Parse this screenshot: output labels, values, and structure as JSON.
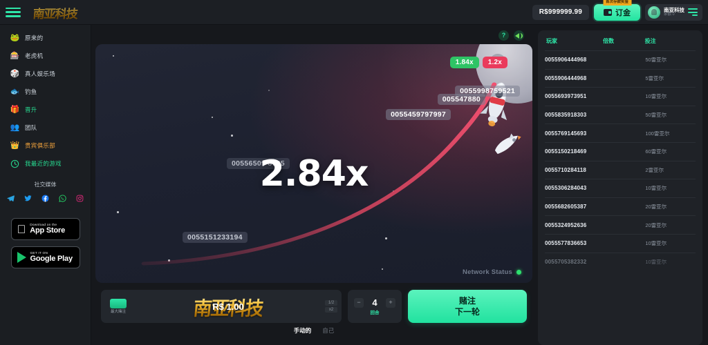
{
  "topbar": {
    "menu_icon": "hamburger-menu-icon",
    "brand": "南亚科技",
    "balance": "R$999999.99",
    "deposit_label": "订金",
    "deposit_badge": "首次存款奖金",
    "deposit_icon": "wallet-icon",
    "user_name": "南亚科技",
    "user_sub": "余额 0",
    "user_menu_icon": "user-menu-icon"
  },
  "sidebar": {
    "items": [
      {
        "label": "原来的",
        "icon": "frog-icon",
        "accent": "default"
      },
      {
        "label": "老虎机",
        "icon": "slot-machine-icon",
        "accent": "default"
      },
      {
        "label": "真人娱乐场",
        "icon": "live-casino-icon",
        "accent": "default"
      },
      {
        "label": "钓鱼",
        "icon": "fishing-icon",
        "accent": "default"
      },
      {
        "label": "晋升",
        "icon": "gift-icon",
        "accent": "green"
      },
      {
        "label": "团队",
        "icon": "team-icon",
        "accent": "default"
      },
      {
        "label": "贵宾俱乐部",
        "icon": "crown-icon",
        "accent": "orange"
      },
      {
        "label": "我最近的游戏",
        "icon": "clock-icon",
        "accent": "green"
      }
    ],
    "social_title": "社交媒体",
    "social": [
      {
        "name": "telegram-icon",
        "color": "#2aa3e0"
      },
      {
        "name": "twitter-icon",
        "color": "#1d9bf0"
      },
      {
        "name": "facebook-icon",
        "color": "#1877f2"
      },
      {
        "name": "whatsapp-icon",
        "color": "#25d366"
      },
      {
        "name": "instagram-icon",
        "color": "#d62976"
      }
    ],
    "stores": [
      {
        "small": "Download on the",
        "big": "App Store",
        "glyph": "apple-icon"
      },
      {
        "small": "GET IT ON",
        "big": "Google Play",
        "glyph": "google-play-icon"
      }
    ]
  },
  "game": {
    "help_icon": "help-icon",
    "sound_icon": "sound-on-icon",
    "multiplier": "2.84x",
    "history_chips": [
      {
        "value": "1.84x",
        "tone": "green"
      },
      {
        "value": "1.2x",
        "tone": "red"
      }
    ],
    "nameplates": [
      "0055998759521",
      "005547880",
      "0055459797997",
      "0055151233194",
      "00556509 8725"
    ],
    "network_status_label": "Network Status",
    "network_status_color": "#2ee06e"
  },
  "controls": {
    "max_bet_label": "最大赌注",
    "bet_amount": "R$ 1.00",
    "bet_watermark": "南亚科技",
    "half_label": "1/2",
    "double_label": "x2",
    "qty_value": "4",
    "qty_label": "回合",
    "qty_minus": "−",
    "qty_plus": "+",
    "bet_line1": "赌注",
    "bet_line2": "下一轮",
    "tabs": [
      {
        "label": "手动的",
        "active": true
      },
      {
        "label": "自己",
        "active": false
      }
    ]
  },
  "leaderboard": {
    "columns": [
      "玩家",
      "倍数",
      "投注"
    ],
    "rows": [
      {
        "player": "0055906444968",
        "mult": "",
        "bet": "50雷亚尔",
        "faded": false
      },
      {
        "player": "0055906444968",
        "mult": "",
        "bet": "5雷亚尔",
        "faded": false
      },
      {
        "player": "0055693973951",
        "mult": "",
        "bet": "10雷亚尔",
        "faded": false
      },
      {
        "player": "0055835918303",
        "mult": "",
        "bet": "50雷亚尔",
        "faded": false
      },
      {
        "player": "0055769145693",
        "mult": "",
        "bet": "100雷亚尔",
        "faded": false
      },
      {
        "player": "0055150218469",
        "mult": "",
        "bet": "60雷亚尔",
        "faded": false
      },
      {
        "player": "0055710284118",
        "mult": "",
        "bet": "2雷亚尔",
        "faded": false
      },
      {
        "player": "0055306284043",
        "mult": "",
        "bet": "10雷亚尔",
        "faded": false
      },
      {
        "player": "0055682605387",
        "mult": "",
        "bet": "20雷亚尔",
        "faded": false
      },
      {
        "player": "0055324952636",
        "mult": "",
        "bet": "20雷亚尔",
        "faded": false
      },
      {
        "player": "0055577836653",
        "mult": "",
        "bet": "10雷亚尔",
        "faded": false
      },
      {
        "player": "0055705382332",
        "mult": "",
        "bet": "10雷亚尔",
        "faded": true
      }
    ]
  }
}
